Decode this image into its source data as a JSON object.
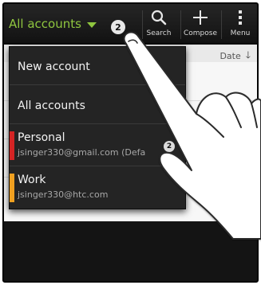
{
  "topbar": {
    "account_selector": "All accounts",
    "unread_badge": "2",
    "search_label": "Search",
    "compose_label": "Compose",
    "menu_label": "Menu"
  },
  "sort": {
    "label": "Date",
    "arrow": "🡓"
  },
  "dropdown": {
    "items": [
      {
        "label": "New account"
      },
      {
        "label": "All accounts"
      },
      {
        "label": "Personal",
        "email": "jsinger330@gmail.com (Defa",
        "badge": "2",
        "accent": "#d42424"
      },
      {
        "label": "Work",
        "email": "jsinger330@htc.com",
        "accent": "#f0a020"
      }
    ]
  },
  "colors": {
    "accent_green": "#8fc63f",
    "personal": "#d42424",
    "work": "#f0a020"
  },
  "icons": [
    "caret-down-icon",
    "search-icon",
    "plus-icon",
    "overflow-menu-icon",
    "sort-down-icon",
    "hand-pointer-icon"
  ]
}
